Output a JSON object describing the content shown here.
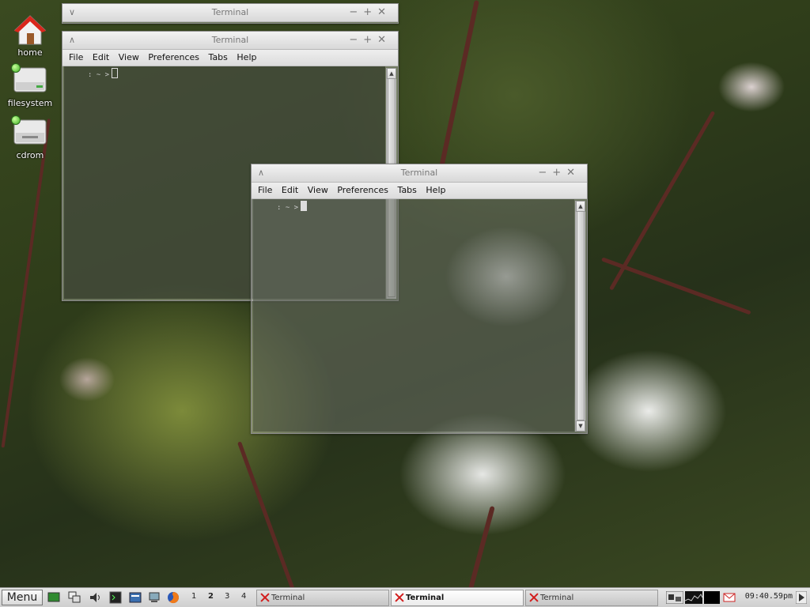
{
  "desktop": {
    "icons": [
      {
        "label": "home"
      },
      {
        "label": "filesystem"
      },
      {
        "label": "cdrom"
      }
    ]
  },
  "windows": [
    {
      "title": "Terminal",
      "menus": [
        "File",
        "Edit",
        "View",
        "Preferences",
        "Tabs",
        "Help"
      ],
      "prompt": ": ~ >"
    },
    {
      "title": "Terminal",
      "menus": [
        "File",
        "Edit",
        "View",
        "Preferences",
        "Tabs",
        "Help"
      ],
      "prompt": ": ~ >"
    },
    {
      "title": "Terminal"
    }
  ],
  "taskbar": {
    "menu_label": "Menu",
    "workspaces": [
      "1",
      "2",
      "3",
      "4"
    ],
    "tasks": [
      {
        "label": "Terminal",
        "active": false
      },
      {
        "label": "Terminal",
        "active": true
      },
      {
        "label": "Terminal",
        "active": false
      }
    ],
    "clock": "09:40.59pm"
  }
}
